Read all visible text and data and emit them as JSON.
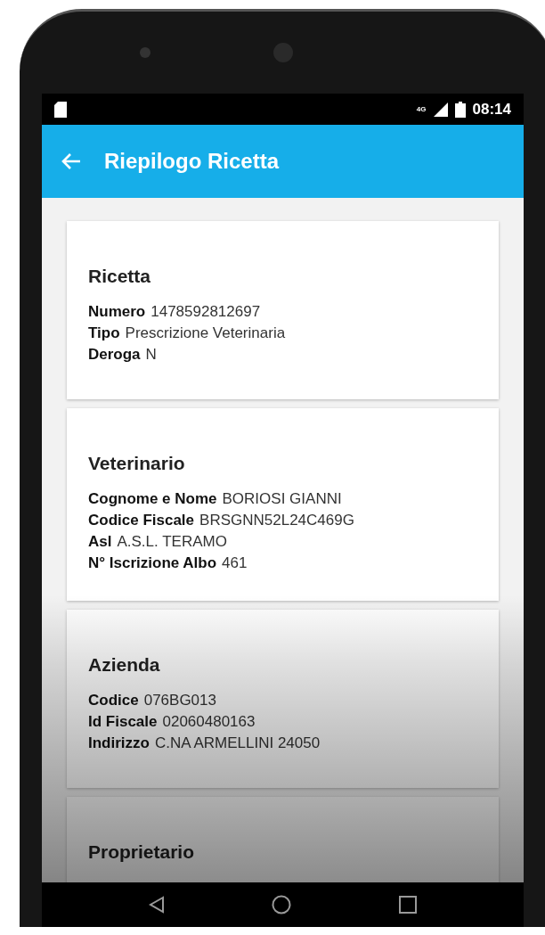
{
  "status_bar": {
    "network": "4G",
    "time": "08:14"
  },
  "app_bar": {
    "title": "Riepilogo Ricetta"
  },
  "cards": [
    {
      "title": "Ricetta",
      "fields": [
        {
          "label": "Numero",
          "value": "1478592812697"
        },
        {
          "label": "Tipo",
          "value": "Prescrizione Veterinaria"
        },
        {
          "label": "Deroga",
          "value": "N"
        }
      ]
    },
    {
      "title": "Veterinario",
      "fields": [
        {
          "label": "Cognome e Nome",
          "value": "BORIOSI GIANNI"
        },
        {
          "label": "Codice Fiscale",
          "value": "BRSGNN52L24C469G"
        },
        {
          "label": "Asl",
          "value": "A.S.L. TERAMO"
        },
        {
          "label": "N° Iscrizione Albo",
          "value": "461"
        }
      ]
    },
    {
      "title": "Azienda",
      "fields": [
        {
          "label": "Codice",
          "value": "076BG013"
        },
        {
          "label": "Id Fiscale",
          "value": "02060480163"
        },
        {
          "label": "Indirizzo",
          "value": "C.NA ARMELLINI 24050"
        }
      ]
    },
    {
      "title": "Proprietario"
    }
  ]
}
